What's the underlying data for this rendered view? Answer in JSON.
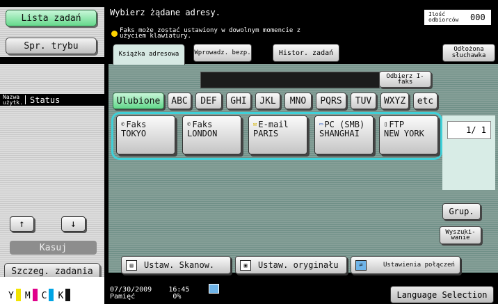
{
  "left": {
    "task_list": "Lista zadań",
    "mode_check": "Spr. trybu",
    "sort_name": "Nazwa użytk.",
    "sort_status": "Status",
    "up_arrow": "↑",
    "down_arrow": "↓",
    "delete": "Kasuj",
    "job_details": "Szczeg. zadania",
    "toner": [
      {
        "label": "Y",
        "color": "#f2e400"
      },
      {
        "label": "M",
        "color": "#e0008a"
      },
      {
        "label": "C",
        "color": "#00a4e4"
      },
      {
        "label": "K",
        "color": "#111111"
      }
    ]
  },
  "header": {
    "title": "Wybierz żądane adresy.",
    "recipients_label": "Ilość odbiorców",
    "recipients_value": "000",
    "info": "Faks może zostać ustawiony w dowolnym momencie z użyciem klawiatury."
  },
  "tabs": {
    "address_book": "Książka adresowa",
    "direct_input": "Wprowadz. bezp.",
    "history": "Histor. zadań",
    "onhook": "Odłożona słuchawka"
  },
  "receive_ifax": "Odbierz I-faks",
  "filters": [
    "Ulubione",
    "ABC",
    "DEF",
    "GHI",
    "JKL",
    "MNO",
    "PQRS",
    "TUV",
    "WXYZ",
    "etc"
  ],
  "destinations": [
    {
      "type": "Faks",
      "name": "TOKYO",
      "icon": "fax-icon"
    },
    {
      "type": "Faks",
      "name": "LONDON",
      "icon": "fax-icon"
    },
    {
      "type": "E-mail",
      "name": "PARIS",
      "icon": "email-icon"
    },
    {
      "type": "PC (SMB)",
      "name": "SHANGHAI",
      "icon": "pc-icon"
    },
    {
      "type": "FTP",
      "name": "NEW YORK",
      "icon": "ftp-icon"
    }
  ],
  "page_indicator": "1/  1",
  "group": "Grup.",
  "search": "Wyszuki-wanie",
  "bottom": {
    "scan_settings": "Ustaw. Skanow.",
    "original_settings": "Ustaw. oryginału",
    "connection_settings": "Ustawienia połączeń"
  },
  "status": {
    "date": "07/30/2009",
    "time": "16:45",
    "memory_label": "Pamięć",
    "memory_value": "0%"
  },
  "language": "Language Selection"
}
